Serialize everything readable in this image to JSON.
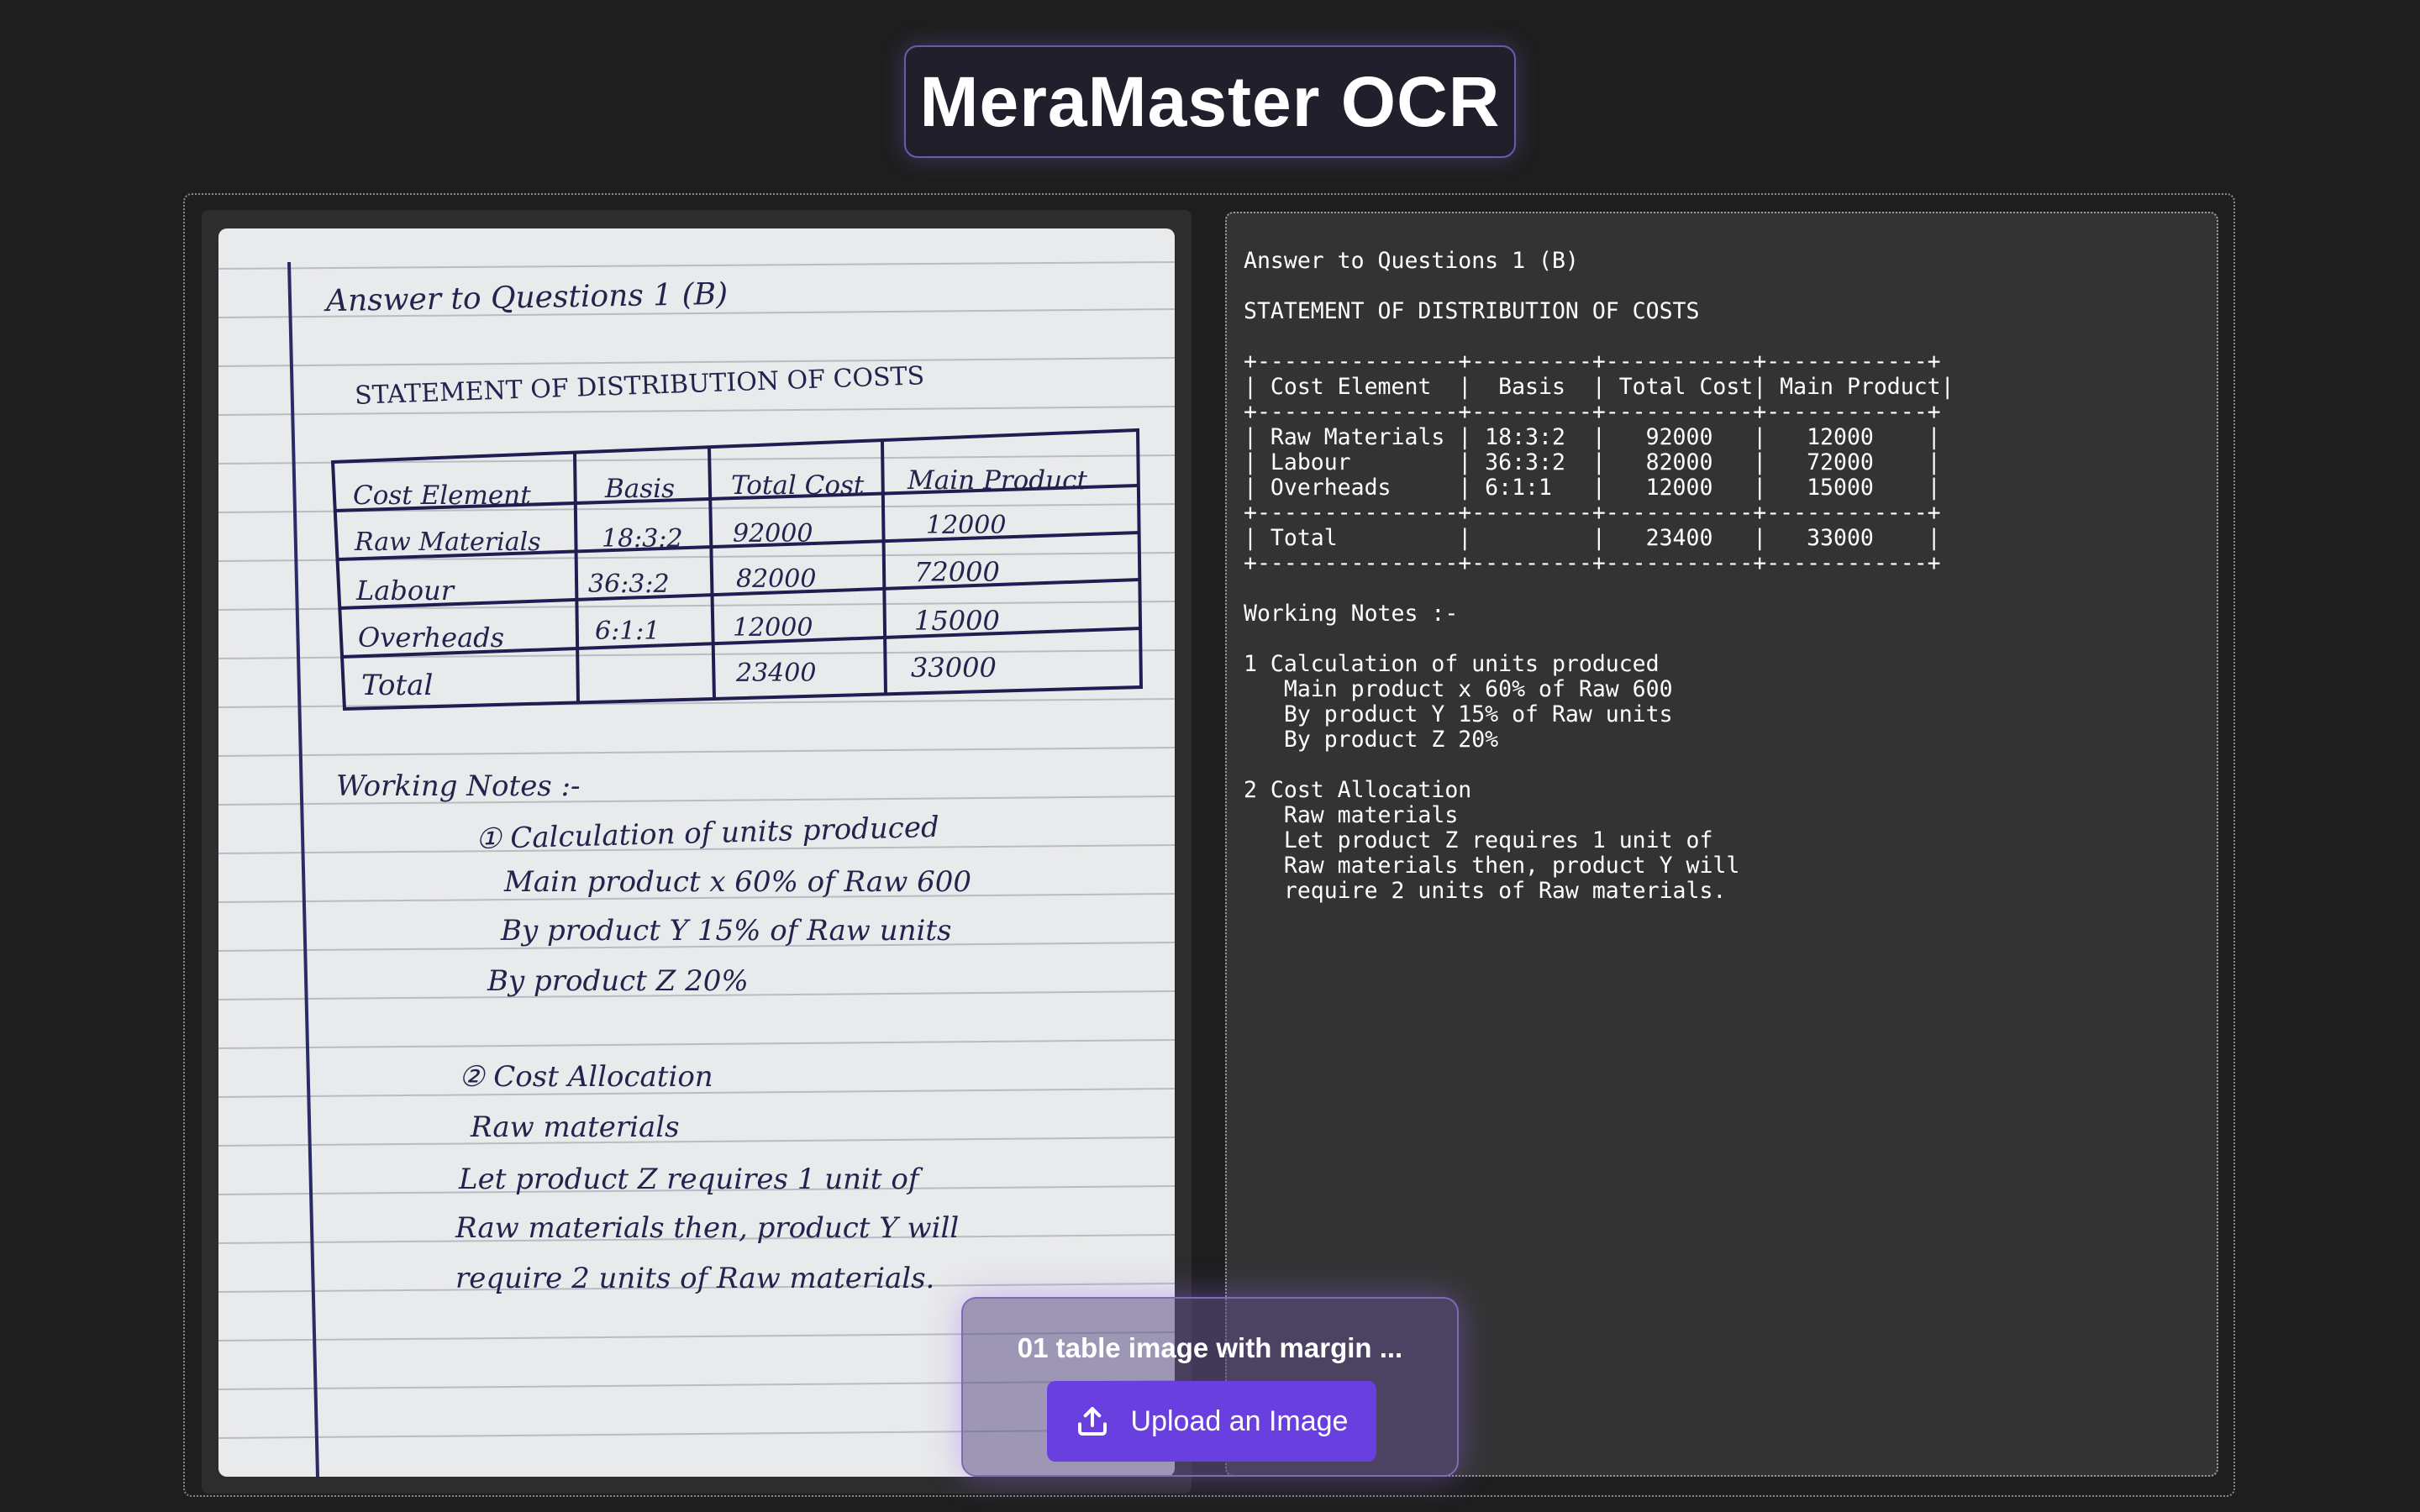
{
  "app": {
    "title": "MeraMaster OCR"
  },
  "image": {
    "heading": "Answer to Questions 1 (B)",
    "subheading": "STATEMENT OF DISTRIBUTION OF COSTS",
    "table": {
      "headers": [
        "Cost Element",
        "Basis",
        "Total Cost",
        "Main Product"
      ],
      "rows": [
        [
          "Raw Materials",
          "18:3:2",
          "92000",
          "12000"
        ],
        [
          "Labour",
          "36:3:2",
          "82000",
          "72000"
        ],
        [
          "Overheads",
          "6:1:1",
          "12000",
          "15000"
        ],
        [
          "Total",
          "",
          "23400",
          "33000"
        ]
      ]
    },
    "notes_heading": "Working Notes :-",
    "notes_lines": [
      "① Calculation of units produced",
      "Main product x 60% of Raw 600",
      "By product Y 15% of Raw units",
      "By product Z 20%",
      "② Cost Allocation",
      "Raw materials",
      "Let product Z requires 1 unit of",
      "Raw materials then, product Y will",
      "require 2 units of Raw materials."
    ]
  },
  "ocr_result": {
    "text": "Answer to Questions 1 (B)\n\nSTATEMENT OF DISTRIBUTION OF COSTS\n\n+---------------+---------+-----------+------------+\n| Cost Element  |  Basis  | Total Cost| Main Product|\n+---------------+---------+-----------+------------+\n| Raw Materials | 18:3:2  |   92000   |   12000    |\n| Labour        | 36:3:2  |   82000   |   72000    |\n| Overheads     | 6:1:1   |   12000   |   15000    |\n+---------------+---------+-----------+------------+\n| Total         |         |   23400   |   33000    |\n+---------------+---------+-----------+------------+\n\nWorking Notes :-\n\n1 Calculation of units produced\n   Main product x 60% of Raw 600\n   By product Y 15% of Raw units\n   By product Z 20%\n\n2 Cost Allocation\n   Raw materials\n   Let product Z requires 1 unit of\n   Raw materials then, product Y will\n   require 2 units of Raw materials."
  },
  "upload": {
    "file_name": "01 table image with margin ...",
    "button_label": "Upload an Image",
    "icon": "upload-icon"
  },
  "colors": {
    "background": "#1e1e1e",
    "accent": "#6a3fe0",
    "panel": "#333333",
    "ink": "#23234e"
  }
}
